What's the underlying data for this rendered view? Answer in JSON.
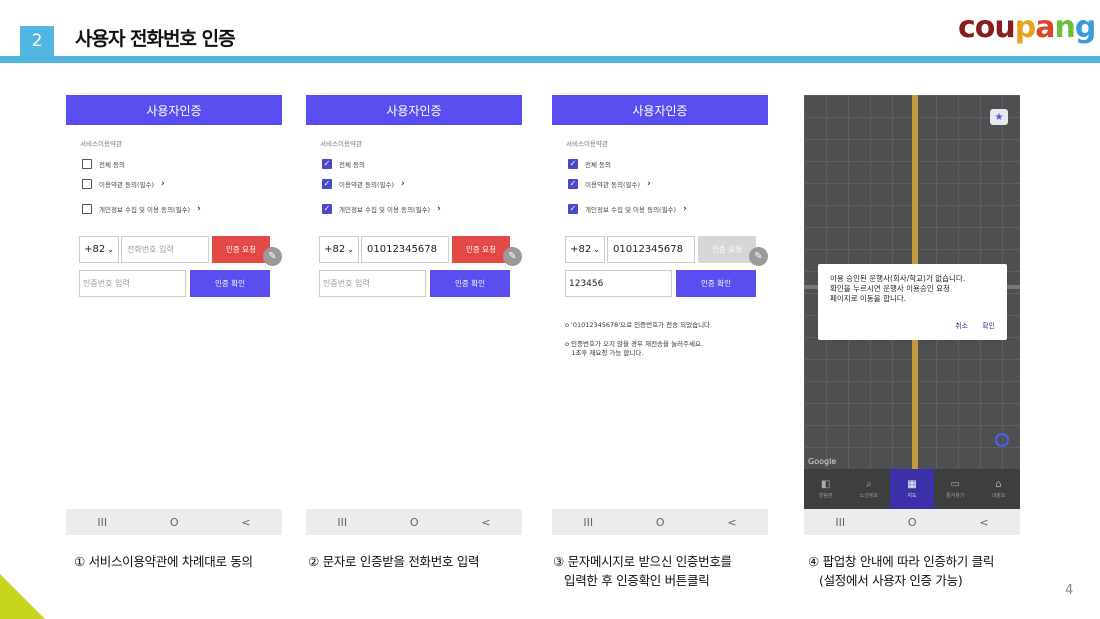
{
  "header": {
    "step_number": "2",
    "title": "사용자 전화번호 인증",
    "logo_letters": [
      {
        "ch": "c",
        "color": "#8b1c1c"
      },
      {
        "ch": "o",
        "color": "#8b1c1c"
      },
      {
        "ch": "u",
        "color": "#8b1c1c"
      },
      {
        "ch": "p",
        "color": "#e9a21d"
      },
      {
        "ch": "a",
        "color": "#d9472b"
      },
      {
        "ch": "n",
        "color": "#6bbf3a"
      },
      {
        "ch": "g",
        "color": "#3b9bd8"
      }
    ],
    "accent_color": "#52b6e3"
  },
  "page_number": "4",
  "screens": [
    {
      "header": "사용자인증",
      "terms_title": "서비스이용약관",
      "checks": [
        {
          "label": "전체 동의",
          "checked": false,
          "arrow": false
        },
        {
          "label": "이용약관 동의(필수)",
          "checked": false,
          "arrow": true
        },
        {
          "label": "개인정보 수집 및 이용 동의(필수)",
          "checked": false,
          "arrow": true
        }
      ],
      "country_code": "+82",
      "phone_placeholder": "전화번호 입력",
      "phone_value": "",
      "request_button": "인증 요청",
      "request_enabled": true,
      "code_placeholder": "인증번호 입력",
      "code_value": "",
      "confirm_button": "인증 확인",
      "notes": [],
      "nav": [
        "III",
        "O",
        "<"
      ]
    },
    {
      "header": "사용자인증",
      "terms_title": "서비스이용약관",
      "checks": [
        {
          "label": "전체 동의",
          "checked": true,
          "arrow": false
        },
        {
          "label": "이용약관 동의(필수)",
          "checked": true,
          "arrow": true
        },
        {
          "label": "개인정보 수집 및 이용 동의(필수)",
          "checked": true,
          "arrow": true
        }
      ],
      "country_code": "+82",
      "phone_placeholder": "",
      "phone_value": "01012345678",
      "request_button": "인증 요청",
      "request_enabled": true,
      "code_placeholder": "인증번호 입력",
      "code_value": "",
      "confirm_button": "인증 확인",
      "notes": [],
      "nav": [
        "III",
        "O",
        "<"
      ]
    },
    {
      "header": "사용자인증",
      "terms_title": "서비스이용약관",
      "checks": [
        {
          "label": "전체 동의",
          "checked": true,
          "arrow": false
        },
        {
          "label": "이용약관 동의(필수)",
          "checked": true,
          "arrow": true
        },
        {
          "label": "개인정보 수집 및 이용 동의(필수)",
          "checked": true,
          "arrow": true
        }
      ],
      "country_code": "+82",
      "phone_placeholder": "",
      "phone_value": "01012345678",
      "request_button": "인증 요청",
      "request_enabled": false,
      "code_placeholder": "",
      "code_value": "123456",
      "confirm_button": "인증 확인",
      "notes": [
        "o '01012345678'으로 인증번호가 전송 되었습니다.",
        "o 인증번호가 오지 않을 경우 재전송을 눌러주세요.\n   1초후 재요청 가능 합니다."
      ],
      "nav": [
        "III",
        "O",
        "<"
      ]
    }
  ],
  "map_screen": {
    "dialog_lines": [
      "이용 승인된 운행사(회사/학교)가 없습니다.",
      "확인을 누르시면 운행사 이용승인 요청",
      "페이지로 이동을 합니다."
    ],
    "cancel_button": "취소",
    "ok_button": "확인",
    "google_label": "Google",
    "tabs": [
      "알림판",
      "노선정보",
      "지도",
      "즐겨찾기",
      "내정보"
    ],
    "active_tab": 2,
    "nav": [
      "III",
      "O",
      "<"
    ]
  },
  "captions": [
    "① 서비스이용약관에 차례대로 동의",
    "② 문자로 인증받을 전화번호 입력",
    "③ 문자메시지로 받으신 인증번호를\n   입력한 후 인증확인 버튼클릭",
    "④ 팝업창 안내에 따라 인증하기 클릭\n   (설정에서 사용자 인증 가능)"
  ]
}
